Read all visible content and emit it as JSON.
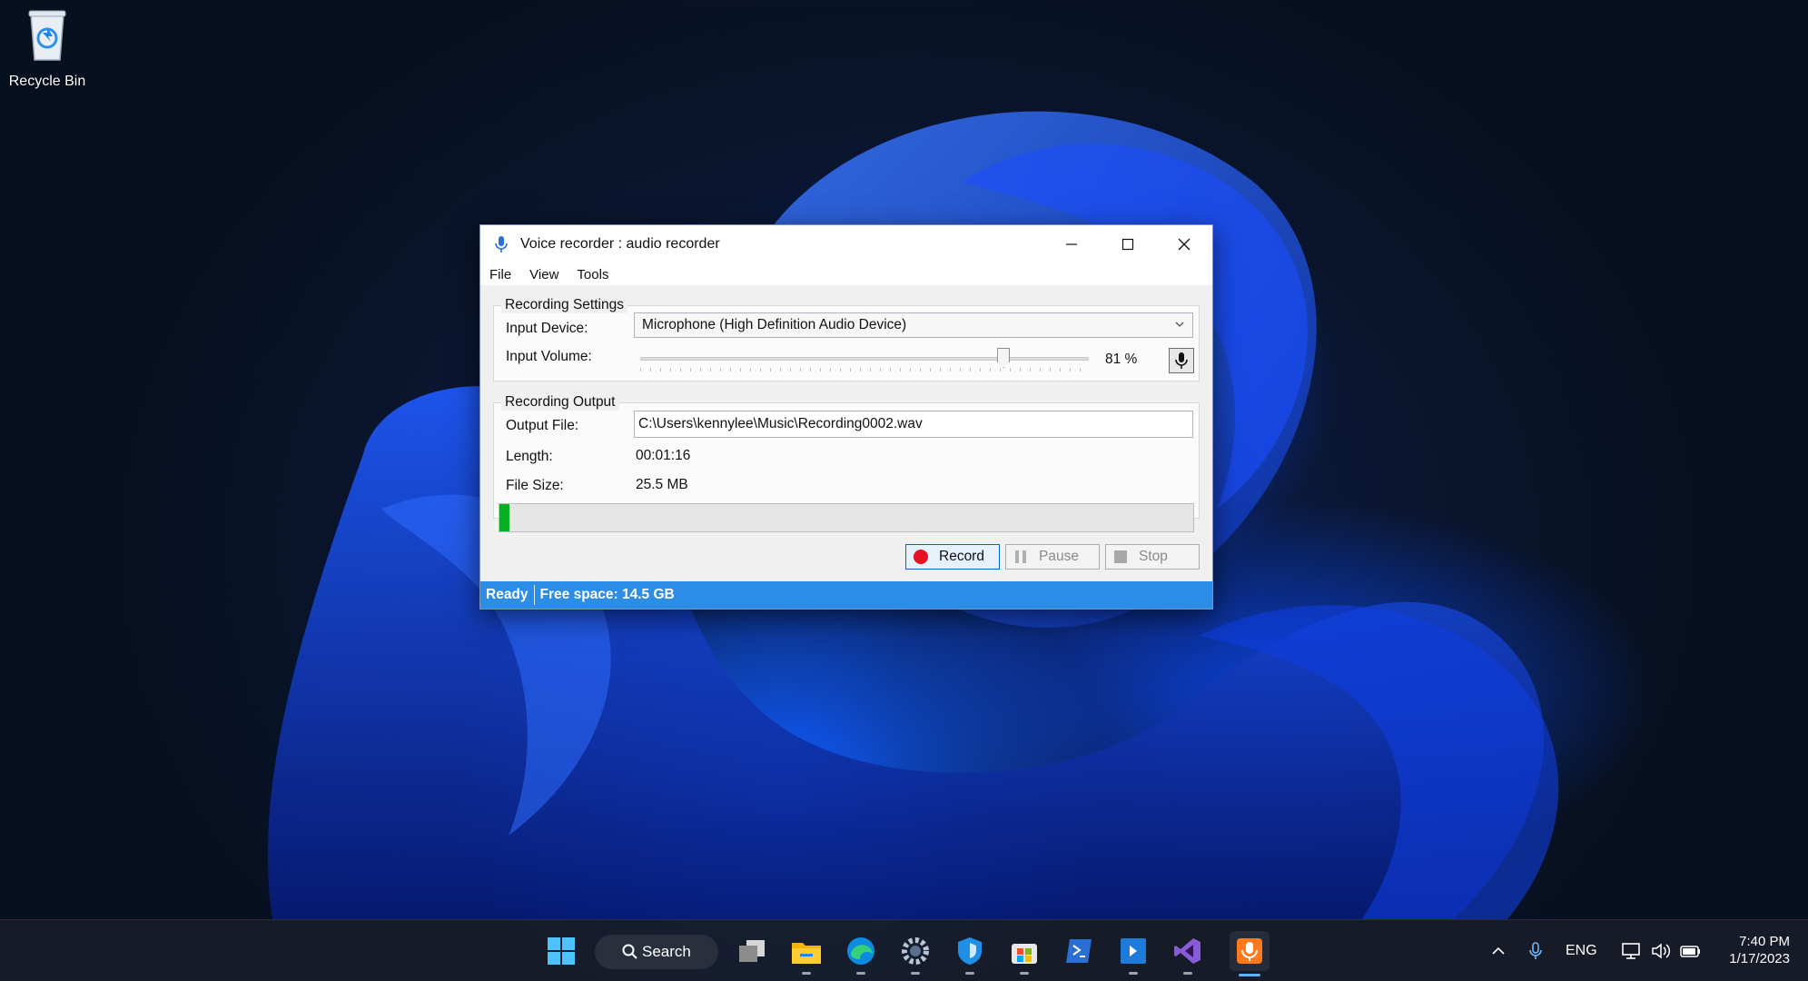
{
  "desktop": {
    "recycle_bin_label": "Recycle Bin"
  },
  "window": {
    "title": "Voice recorder : audio recorder",
    "menu": [
      "File",
      "View",
      "Tools"
    ],
    "recording_settings": {
      "group_title": "Recording Settings",
      "input_device_label": "Input Device:",
      "input_device_value": "Microphone (High Definition Audio Device)",
      "input_volume_label": "Input Volume:",
      "input_volume_percent": 81,
      "input_volume_text": "81 %"
    },
    "recording_output": {
      "group_title": "Recording Output",
      "output_file_label": "Output File:",
      "output_file_value": "C:\\Users\\kennylee\\Music\\Recording0002.wav",
      "length_label": "Length:",
      "length_value": "00:01:16",
      "file_size_label": "File Size:",
      "file_size_value": "25.5 MB",
      "progress_fraction": 0.015
    },
    "buttons": {
      "record": "Record",
      "pause": "Pause",
      "stop": "Stop"
    },
    "status": {
      "state": "Ready",
      "free_space": "Free space: 14.5 GB"
    }
  },
  "taskbar": {
    "search_label": "Search",
    "language": "ENG",
    "time": "7:40 PM",
    "date": "1/17/2023",
    "apps": [
      "start-icon",
      "task-view-icon",
      "file-explorer-icon",
      "edge-icon",
      "settings-icon",
      "security-icon",
      "store-icon",
      "terminal-icon",
      "remote-desktop-icon",
      "visual-studio-icon",
      "voice-recorder-icon"
    ]
  },
  "colors": {
    "accent": "#2b8de6",
    "progress": "#06b025",
    "record_dot": "#e81123"
  }
}
